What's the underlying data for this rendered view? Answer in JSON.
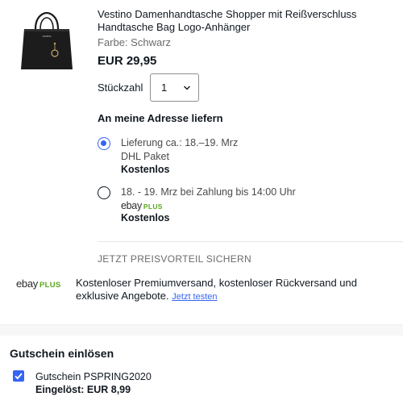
{
  "product": {
    "title": "Vestino Damenhandtasche Shopper mit Reißverschluss Handtasche Bag Logo-Anhänger",
    "color": "Farbe: Schwarz",
    "price": "EUR 29,95",
    "image_icon": "black-handbag-image"
  },
  "quantity": {
    "label": "Stückzahl",
    "value": "1"
  },
  "shipping": {
    "heading": "An meine Adresse liefern",
    "options": [
      {
        "selected": true,
        "line1": "Lieferung ca.: 18.–19. Mrz",
        "line2": "DHL Paket",
        "cost": "Kostenlos"
      },
      {
        "selected": false,
        "line1": "18. - 19. Mrz bei Zahlung bis 14:00 Uhr",
        "brand_ebay": "ebay",
        "brand_plus": "PLUS",
        "cost": "Kostenlos"
      }
    ]
  },
  "promo": {
    "heading": "JETZT PREISVORTEIL SICHERN",
    "brand_ebay": "ebay",
    "brand_plus": "PLUS",
    "text": "Kostenloser Premiumversand, kostenloser Rückversand und exklusive Angebote.",
    "link": "Jetzt testen"
  },
  "voucher": {
    "heading": "Gutschein einlösen",
    "code": "Gutschein PSPRING2020",
    "redeemed": "Eingelöst: EUR 8,99",
    "checked": true
  },
  "colors": {
    "accent_blue": "#3665f3",
    "plus_green": "#5ba71b",
    "text": "#111820",
    "muted": "#6b6b6b"
  }
}
